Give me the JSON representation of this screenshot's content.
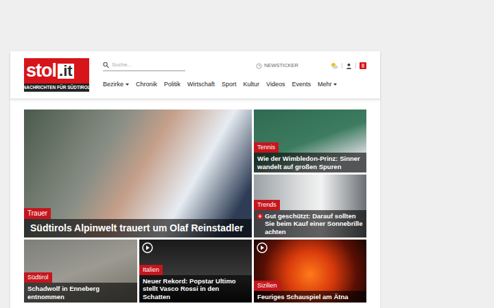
{
  "logo": {
    "name": "stol",
    "suffix": ".it",
    "tagline": "NACHRICHTEN FÜR SÜDTIROL"
  },
  "search": {
    "placeholder": "Suche..."
  },
  "newsticker": "NEWSTICKER",
  "nav": [
    {
      "label": "Bezirke",
      "dropdown": true
    },
    {
      "label": "Chronik",
      "dropdown": false
    },
    {
      "label": "Politik",
      "dropdown": false
    },
    {
      "label": "Wirtschaft",
      "dropdown": false
    },
    {
      "label": "Sport",
      "dropdown": false
    },
    {
      "label": "Kultur",
      "dropdown": false
    },
    {
      "label": "Videos",
      "dropdown": false
    },
    {
      "label": "Events",
      "dropdown": false
    },
    {
      "label": "Mehr",
      "dropdown": true
    }
  ],
  "tiles": [
    {
      "category": "Trauer",
      "title": "Südtirols Alpinwelt trauert um Olaf Reinstadler",
      "video": false,
      "premium": false
    },
    {
      "category": "Tennis",
      "title": "Wie der Wimbledon-Prinz: Sinner wandelt auf großen Spuren",
      "video": false,
      "premium": false
    },
    {
      "category": "Trends",
      "title": "Gut geschützt: Darauf sollten Sie beim Kauf einer Sonnebrille achten",
      "video": false,
      "premium": true
    },
    {
      "category": "Südtirol",
      "title": "Schadwolf in Enneberg entnommen",
      "video": false,
      "premium": false
    },
    {
      "category": "Italien",
      "title": "Neuer Rekord: Popstar Ultimo stellt Vasco Rossi in den Schatten",
      "video": true,
      "premium": false
    },
    {
      "category": "Sizilien",
      "title": "Feuriges Schauspiel am Ätna",
      "video": true,
      "premium": false
    }
  ]
}
